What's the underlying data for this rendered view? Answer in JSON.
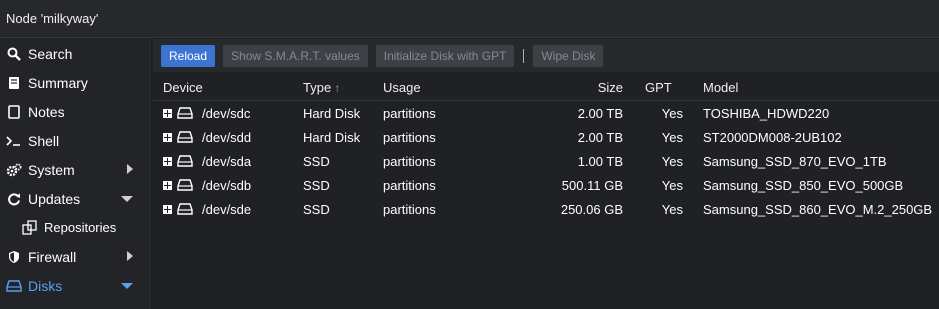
{
  "title": "Node 'milkyway'",
  "sidebar": {
    "items": [
      {
        "label": "Search"
      },
      {
        "label": "Summary"
      },
      {
        "label": "Notes"
      },
      {
        "label": "Shell"
      },
      {
        "label": "System"
      },
      {
        "label": "Updates"
      },
      {
        "label": "Repositories"
      },
      {
        "label": "Firewall"
      },
      {
        "label": "Disks"
      }
    ]
  },
  "toolbar": {
    "reload": "Reload",
    "smart": "Show S.M.A.R.T. values",
    "init_gpt": "Initialize Disk with GPT",
    "wipe": "Wipe Disk"
  },
  "table": {
    "headers": {
      "device": "Device",
      "type": "Type",
      "usage": "Usage",
      "size": "Size",
      "gpt": "GPT",
      "model": "Model"
    },
    "rows": [
      {
        "device": "/dev/sdc",
        "type": "Hard Disk",
        "usage": "partitions",
        "size": "2.00 TB",
        "gpt": "Yes",
        "model": "TOSHIBA_HDWD220"
      },
      {
        "device": "/dev/sdd",
        "type": "Hard Disk",
        "usage": "partitions",
        "size": "2.00 TB",
        "gpt": "Yes",
        "model": "ST2000DM008-2UB102"
      },
      {
        "device": "/dev/sda",
        "type": "SSD",
        "usage": "partitions",
        "size": "1.00 TB",
        "gpt": "Yes",
        "model": "Samsung_SSD_870_EVO_1TB"
      },
      {
        "device": "/dev/sdb",
        "type": "SSD",
        "usage": "partitions",
        "size": "500.11 GB",
        "gpt": "Yes",
        "model": "Samsung_SSD_850_EVO_500GB"
      },
      {
        "device": "/dev/sde",
        "type": "SSD",
        "usage": "partitions",
        "size": "250.06 GB",
        "gpt": "Yes",
        "model": "Samsung_SSD_860_EVO_M.2_250GB"
      }
    ]
  },
  "colors": {
    "accent": "#3c75d1",
    "active_nav": "#5a9ef6"
  }
}
